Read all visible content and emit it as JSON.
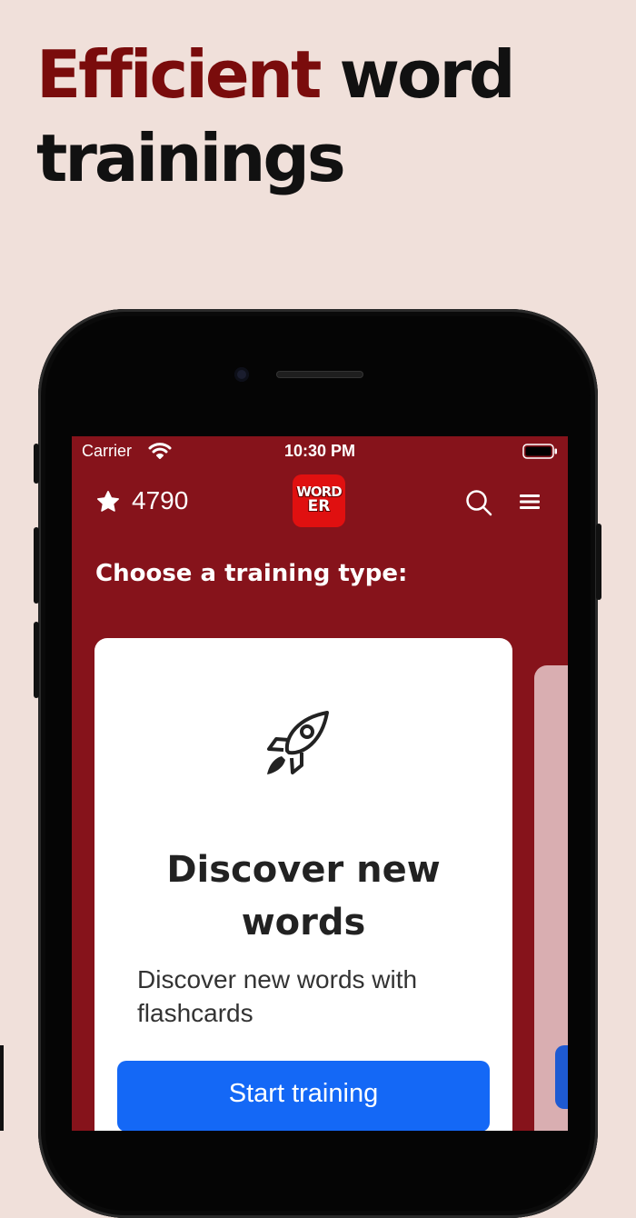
{
  "headline": {
    "accent": "Efficient",
    "rest_line1": "word",
    "line2": "trainings"
  },
  "status_bar": {
    "carrier": "Carrier",
    "time": "10:30 PM"
  },
  "app_header": {
    "score": "4790",
    "logo_line1": "WORD",
    "logo_line2": "ER"
  },
  "section_title": "Choose a training type:",
  "card": {
    "title": "Discover new words",
    "description": "Discover new words with flashcards",
    "button_label": "Start training"
  },
  "icons": [
    "star-icon",
    "search-icon",
    "menu-icon",
    "rocket-icon",
    "wifi-icon",
    "battery-icon"
  ],
  "colors": {
    "background": "#f0e0da",
    "accent": "#7a0c0c",
    "app_bar": "#86131b",
    "logo": "#e01010",
    "button": "#1468f6"
  }
}
